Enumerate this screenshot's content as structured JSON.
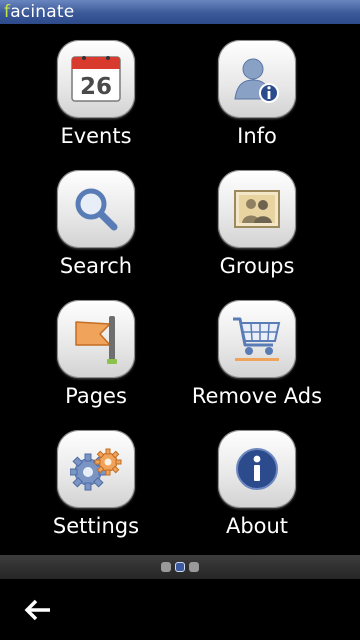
{
  "app": {
    "brand_first": "f",
    "brand_rest": "acinate"
  },
  "menu": {
    "events": {
      "label": "Events",
      "calendar_day": "26"
    },
    "info": {
      "label": "Info"
    },
    "search": {
      "label": "Search"
    },
    "groups": {
      "label": "Groups"
    },
    "pages": {
      "label": "Pages"
    },
    "remove_ads": {
      "label": "Remove Ads"
    },
    "settings": {
      "label": "Settings"
    },
    "about": {
      "label": "About"
    }
  },
  "pager": {
    "pages": 3,
    "current": 2
  },
  "icons": {
    "events": "calendar-icon",
    "info": "user-info-icon",
    "search": "magnifier-icon",
    "groups": "group-photo-icon",
    "pages": "flag-icon",
    "remove_ads": "shopping-cart-icon",
    "settings": "gears-icon",
    "about": "info-badge-icon",
    "back": "back-arrow-icon"
  },
  "colors": {
    "brand_blue": "#3b5998",
    "brand_accent": "#c6e14a",
    "background": "#000000"
  }
}
